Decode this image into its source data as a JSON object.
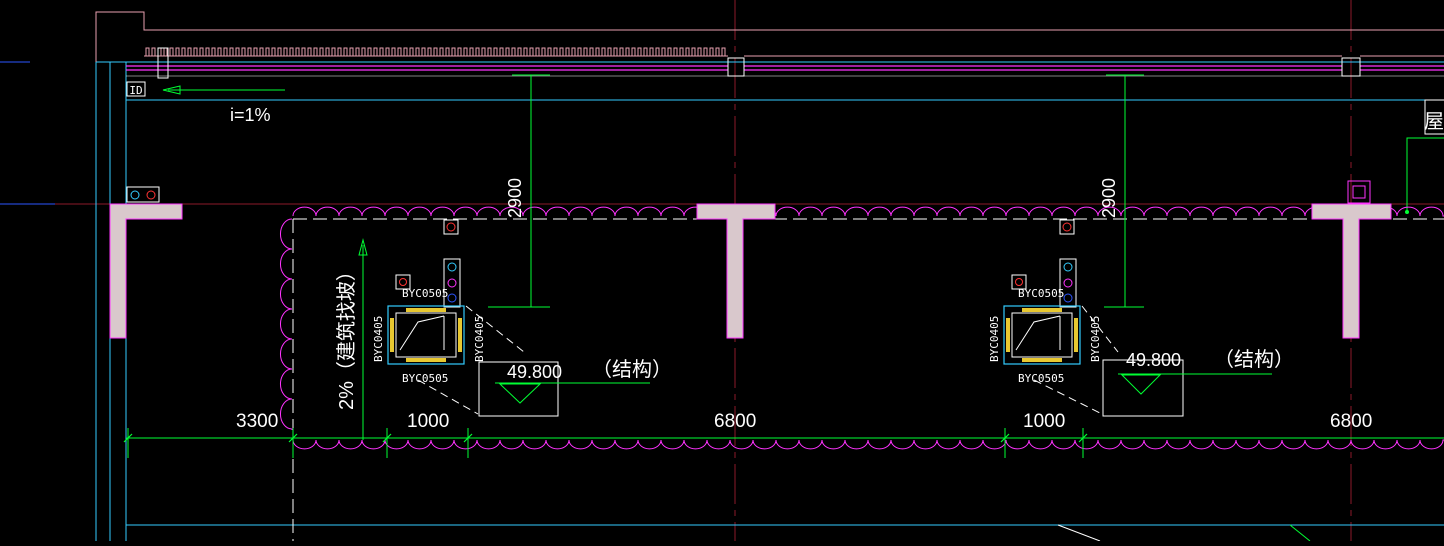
{
  "drawing": {
    "background": "#000000",
    "colors": {
      "axis": "#8b1a2a",
      "cyan": "#33ccff",
      "blue": "#2d56ff",
      "green": "#00ff33",
      "magenta": "#ff33ff",
      "white": "#ffffff",
      "pink": "#e8a0b0",
      "concrete": "#d9c8cc",
      "yellow": "#e8c830",
      "red": "#ff3333"
    },
    "slope_label": "i=1%",
    "side_marker": "屋",
    "left_tag": "ID",
    "vertical_note": "2%（建筑找坡）",
    "dim_vertical": "2900",
    "dim_left": "3300",
    "dim_unit_width": "1000",
    "dim_span": "6800",
    "elevation": "49.800",
    "elevation_note": "（结构）",
    "ducts": {
      "top": "BYC0505",
      "bottom": "BYC0505",
      "left": "BYC0405",
      "right": "BYC0405"
    }
  }
}
